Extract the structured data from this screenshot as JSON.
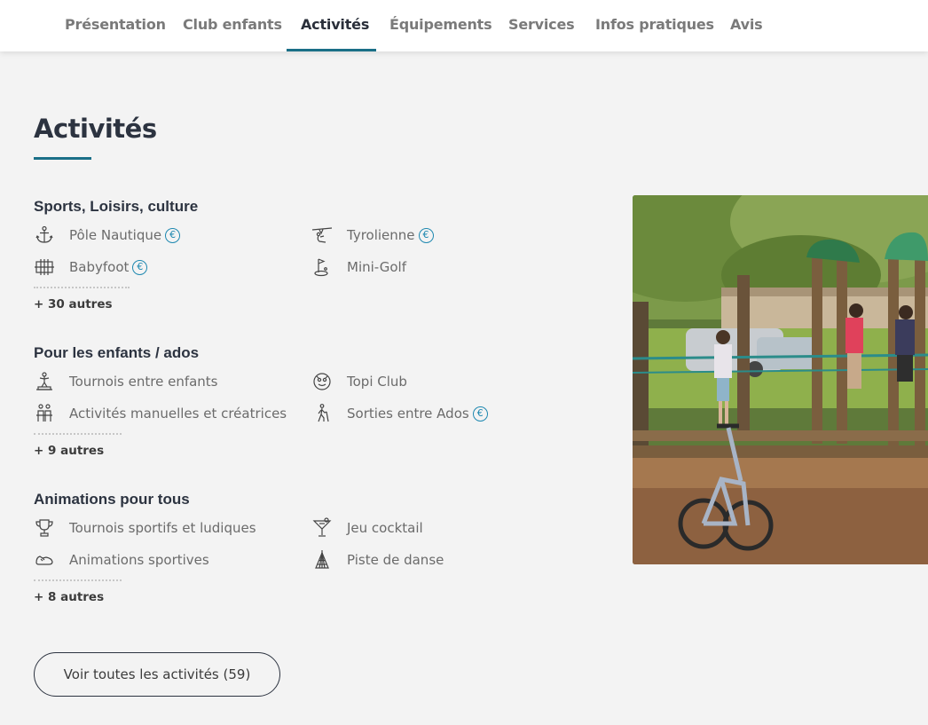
{
  "nav": {
    "tabs": [
      {
        "label": "Présentation"
      },
      {
        "label": "Club enfants"
      },
      {
        "label": "Activités"
      },
      {
        "label": "Équipements"
      },
      {
        "label": "Services"
      },
      {
        "label": "Infos pratiques"
      },
      {
        "label": "Avis"
      }
    ],
    "active_tab": "Activités"
  },
  "page": {
    "title": "Activités"
  },
  "sections": [
    {
      "heading": "Sports, Loisirs, culture",
      "items": [
        {
          "label": "Pôle Nautique",
          "icon": "anchor-icon",
          "paid": true,
          "euro": "€"
        },
        {
          "label": "Tyrolienne",
          "icon": "zipline-icon",
          "paid": true,
          "euro": "€"
        },
        {
          "label": "Babyfoot",
          "icon": "babyfoot-icon",
          "paid": true,
          "euro": "€"
        },
        {
          "label": "Mini-Golf",
          "icon": "minigolf-icon",
          "paid": false
        }
      ],
      "more": "+ 30 autres"
    },
    {
      "heading": "Pour les enfants / ados",
      "items": [
        {
          "label": "Tournois entre enfants",
          "icon": "kids-tournament-icon",
          "paid": false
        },
        {
          "label": "Topi Club",
          "icon": "topi-club-icon",
          "paid": false
        },
        {
          "label": "Activités manuelles et créatrices",
          "icon": "crafts-icon",
          "paid": false
        },
        {
          "label": "Sorties entre Ados",
          "icon": "hiking-icon",
          "paid": true,
          "euro": "€"
        }
      ],
      "more": "+ 9 autres"
    },
    {
      "heading": "Animations pour tous",
      "items": [
        {
          "label": "Tournois sportifs et ludiques",
          "icon": "trophy-icon",
          "paid": false
        },
        {
          "label": "Jeu cocktail",
          "icon": "cocktail-icon",
          "paid": false
        },
        {
          "label": "Animations sportives",
          "icon": "sneaker-icon",
          "paid": false
        },
        {
          "label": "Piste de danse",
          "icon": "disco-ball-icon",
          "paid": false
        }
      ],
      "more": "+ 8 autres"
    }
  ],
  "cta": {
    "label": "Voir toutes les activités (59)"
  },
  "colors": {
    "accent": "#1a6f87",
    "euro": "#1e88b0",
    "heading": "#2c3340",
    "background": "#f3f3f3"
  }
}
